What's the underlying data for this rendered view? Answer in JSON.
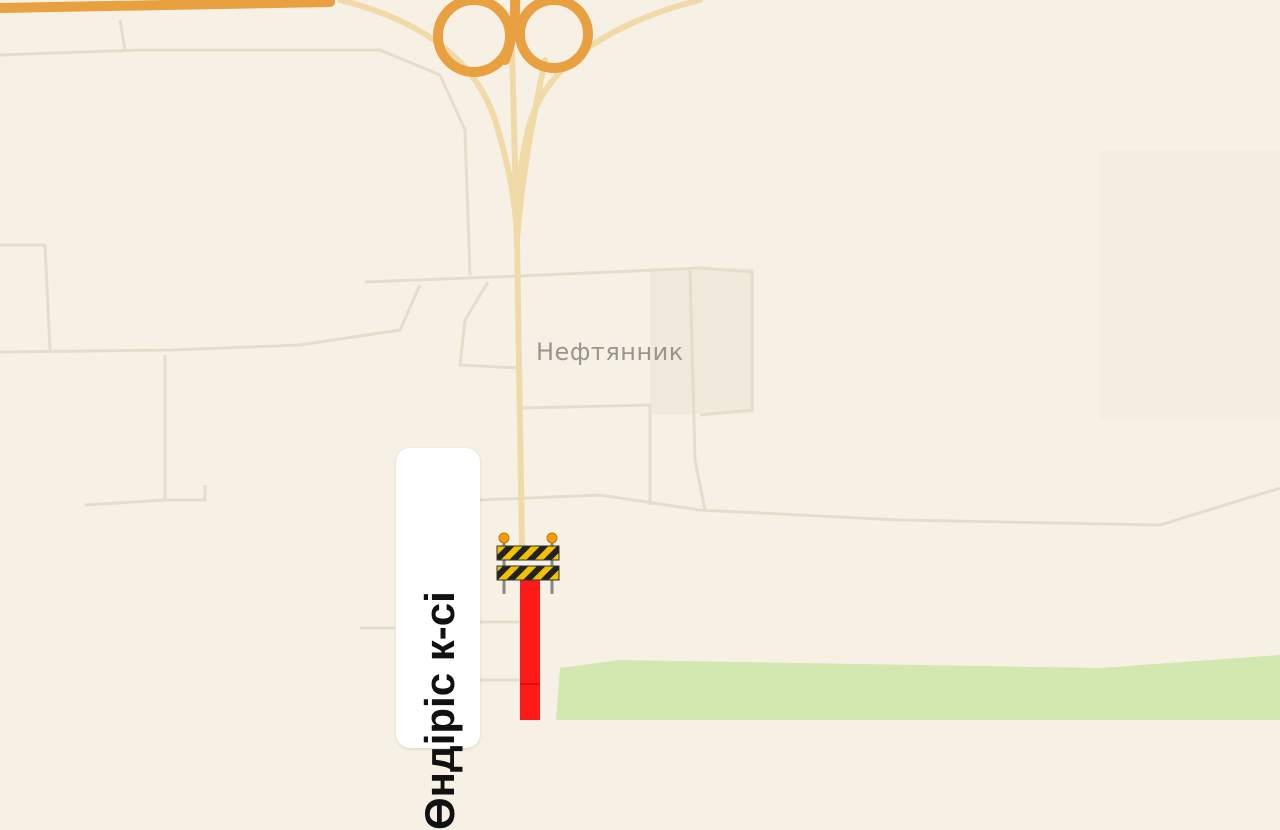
{
  "map": {
    "district_label": "Нефтянник",
    "street_label": "Өндіріс к-сі",
    "colors": {
      "background": "#f6f1e4",
      "minor_road": "#e4ddcc",
      "main_road": "#f0dba8",
      "highway": "#e8a040",
      "park": "#d2e8b0",
      "closed_road": "#ff1a1a",
      "barrier_stripe_dark": "#222222",
      "barrier_stripe_light": "#f2c200"
    },
    "icons": {
      "roadblock": "road-closed-barrier-icon"
    }
  }
}
